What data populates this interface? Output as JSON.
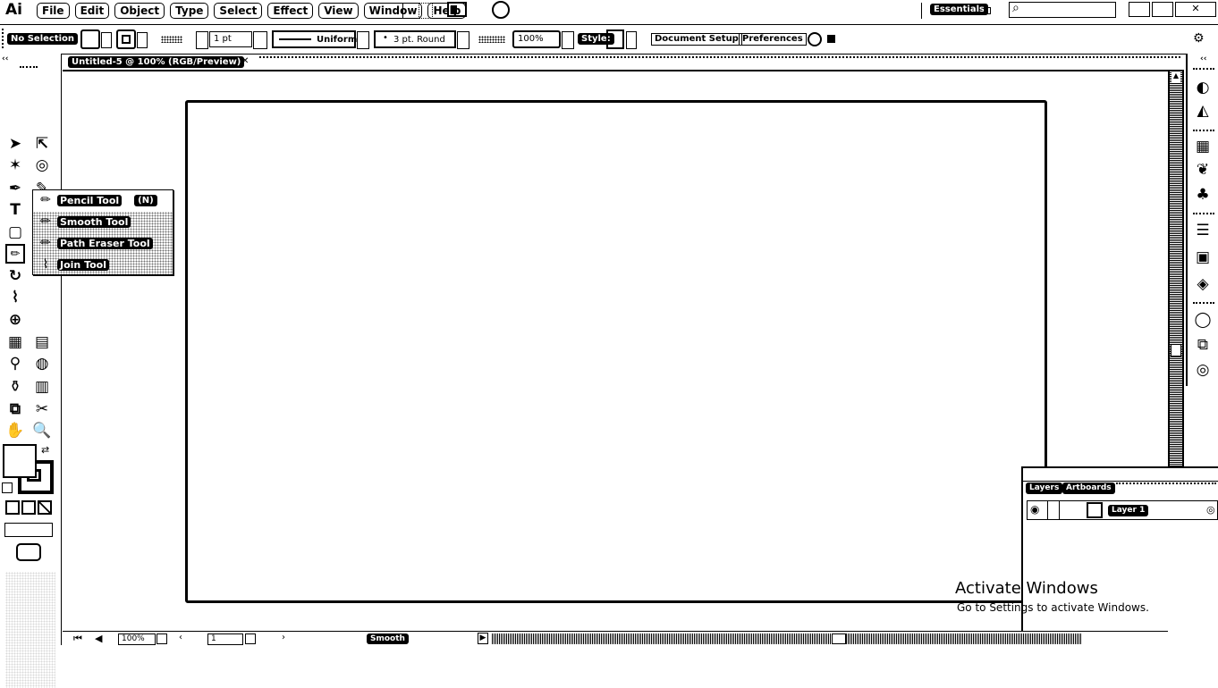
{
  "app": {
    "logo": "Ai"
  },
  "menubar": {
    "items": [
      "File",
      "Edit",
      "Object",
      "Type",
      "Select",
      "Effect",
      "View",
      "Window",
      "Help"
    ],
    "workspace": "Essentials",
    "search_placeholder": ""
  },
  "control_bar": {
    "selection": "No Selection",
    "stroke_weight": "1 pt",
    "profile": "Uniform",
    "brush": "3 pt. Round",
    "opacity": "100%",
    "style_label": "Style:",
    "document_setup": "Document Setup",
    "preferences": "Preferences"
  },
  "document": {
    "tab_title": "Untitled-5 @ 100% (RGB/Preview)"
  },
  "flyout": {
    "items": [
      {
        "label": "Pencil Tool",
        "shortcut": "(N)",
        "icon": "pencil-icon"
      },
      {
        "label": "Smooth Tool",
        "icon": "smooth-icon"
      },
      {
        "label": "Path Eraser Tool",
        "icon": "path-eraser-icon"
      },
      {
        "label": "Join Tool",
        "icon": "join-icon"
      }
    ]
  },
  "layers_panel": {
    "tabs": [
      "Layers",
      "Artboards"
    ],
    "layer_name": "Layer 1"
  },
  "status_bar": {
    "zoom": "100%",
    "artboard": "1",
    "tool_name": "Smooth"
  },
  "watermark": {
    "title": "Activate Windows",
    "subtitle": "Go to Settings to activate Windows."
  }
}
